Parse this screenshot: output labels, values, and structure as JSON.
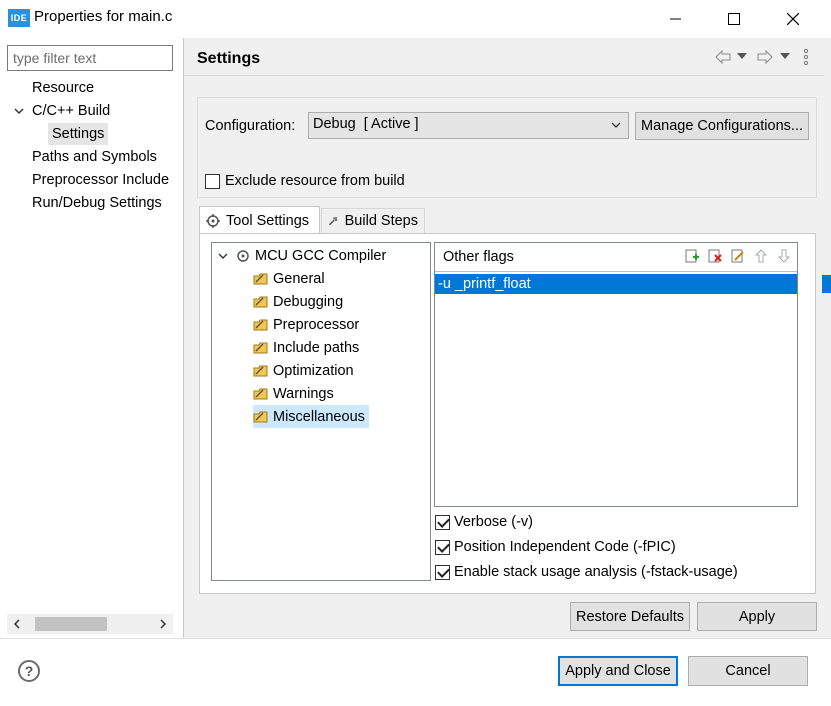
{
  "window": {
    "app_icon_text": "IDE",
    "title": "Properties for main.c",
    "minimize_icon": "minimize-icon",
    "maximize_icon": "maximize-icon",
    "close_icon": "close-icon"
  },
  "nav": {
    "filter_placeholder": "type filter text",
    "items": [
      {
        "label": "Resource"
      },
      {
        "label": "C/C++ Build",
        "expanded": true
      },
      {
        "label": "Settings",
        "selected": true
      },
      {
        "label": "Paths and Symbols"
      },
      {
        "label": "Preprocessor Include"
      },
      {
        "label": "Run/Debug Settings"
      }
    ]
  },
  "header": {
    "title": "Settings",
    "icons": [
      "back-arrow-icon",
      "dropdown-icon",
      "forward-arrow-icon",
      "dropdown-icon",
      "view-menu-icon"
    ]
  },
  "config": {
    "label": "Configuration:",
    "value": "Debug  [ Active ]",
    "manage_button": "Manage Configurations...",
    "exclude_label": "Exclude resource from build",
    "exclude_checked": false
  },
  "tabs": [
    {
      "label": "Tool Settings",
      "icon": "tool-settings-icon",
      "active": true
    },
    {
      "label": "Build Steps",
      "icon": "build-steps-icon",
      "active": false
    }
  ],
  "tool_tree": {
    "root": "MCU GCC Compiler",
    "children": [
      {
        "label": "General"
      },
      {
        "label": "Debugging"
      },
      {
        "label": "Preprocessor"
      },
      {
        "label": "Include paths"
      },
      {
        "label": "Optimization"
      },
      {
        "label": "Warnings"
      },
      {
        "label": "Miscellaneous",
        "selected": true
      }
    ]
  },
  "other_flags": {
    "header": "Other flags",
    "tool_icons": [
      "add-icon",
      "delete-icon",
      "edit-icon",
      "move-up-icon",
      "move-down-icon"
    ],
    "items": [
      "-u _printf_float"
    ]
  },
  "options": [
    {
      "label": "Verbose (-v)",
      "checked": true
    },
    {
      "label": "Position Independent Code (-fPIC)",
      "checked": true
    },
    {
      "label": "Enable stack usage analysis (-fstack-usage)",
      "checked": true
    }
  ],
  "buttons": {
    "restore_defaults": "Restore Defaults",
    "apply": "Apply",
    "apply_and_close": "Apply and Close",
    "cancel": "Cancel"
  },
  "colors": {
    "selection": "#0078d7",
    "tree_selection": "#cce8ff",
    "panel_bg": "#f0f0f0"
  }
}
